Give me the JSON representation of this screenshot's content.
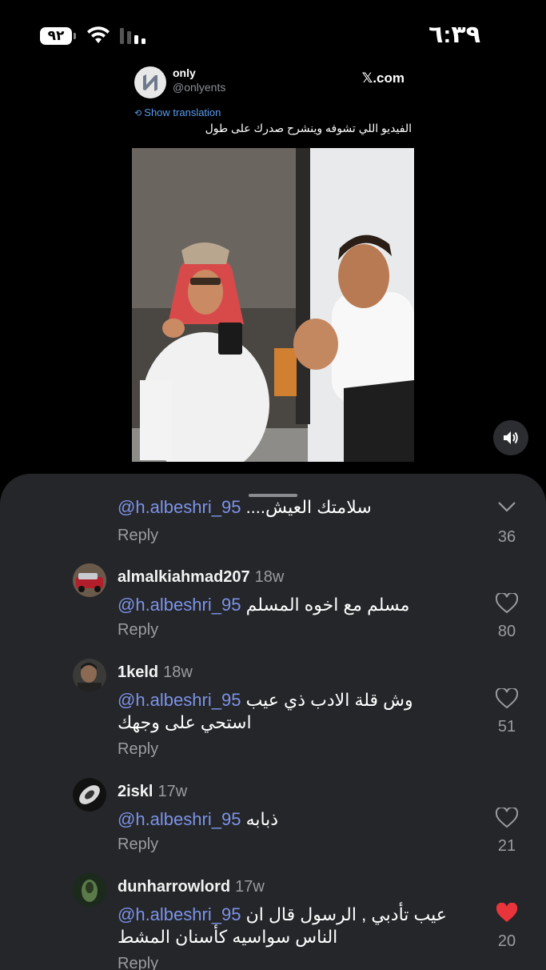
{
  "status_bar": {
    "battery": "٩٢",
    "time": "٦:٣٩"
  },
  "tweet": {
    "author": "only",
    "handle": "@onlyents",
    "site": "𝕏.com",
    "show_translation": "Show translation",
    "text": "الفيديو اللي تشوفه وينشرح صدرك على طول"
  },
  "comments": [
    {
      "username": "",
      "time": "",
      "mention": "@h.albeshri_95",
      "text": "....سلامتك العيش",
      "reply": "Reply",
      "likes": "36",
      "liked": false
    },
    {
      "username": "almalkiahmad207",
      "time": "18w",
      "mention": "@h.albeshri_95",
      "text": "مسلم مع اخوه المسلم",
      "reply": "Reply",
      "likes": "80",
      "liked": false
    },
    {
      "username": "1keld",
      "time": "18w",
      "mention": "@h.albeshri_95",
      "text": "وش قلة الادب ذي عيب",
      "text2": "استحي على وجهك",
      "reply": "Reply",
      "likes": "51",
      "liked": false
    },
    {
      "username": "2iskl",
      "time": "17w",
      "mention": "@h.albeshri_95",
      "text": "ذبابه",
      "reply": "Reply",
      "likes": "21",
      "liked": false
    },
    {
      "username": "dunharrowlord",
      "time": "17w",
      "mention": "@h.albeshri_95",
      "text": "عيب تأدبي , الرسول قال ان",
      "text2": "الناس سواسيه كأسنان المشط",
      "reply": "Reply",
      "likes": "20",
      "liked": true
    }
  ],
  "colors": {
    "mention": "#7d93e8",
    "like_active": "#e8343a",
    "sheet_bg": "#242629"
  }
}
